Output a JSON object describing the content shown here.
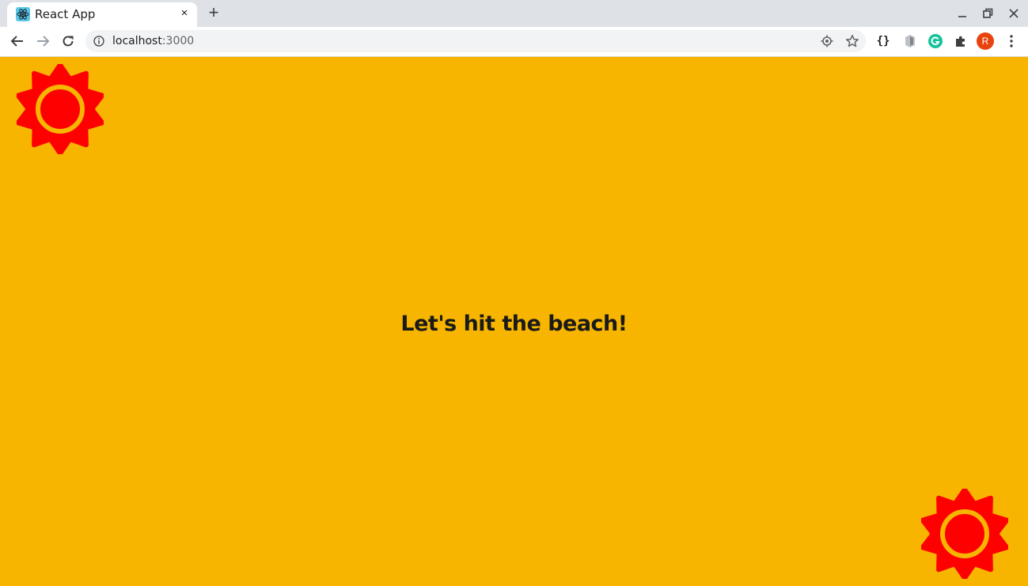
{
  "browser": {
    "tab": {
      "title": "React App",
      "close_glyph": "×"
    },
    "new_tab_glyph": "+",
    "address": {
      "host": "localhost",
      "port": ":3000"
    },
    "extensions": {
      "json_label": "{}"
    },
    "profile_initial": "R"
  },
  "page": {
    "headline": "Let's hit the beach!",
    "background_color": "#f7b500",
    "sun_color": "#ff0000"
  }
}
